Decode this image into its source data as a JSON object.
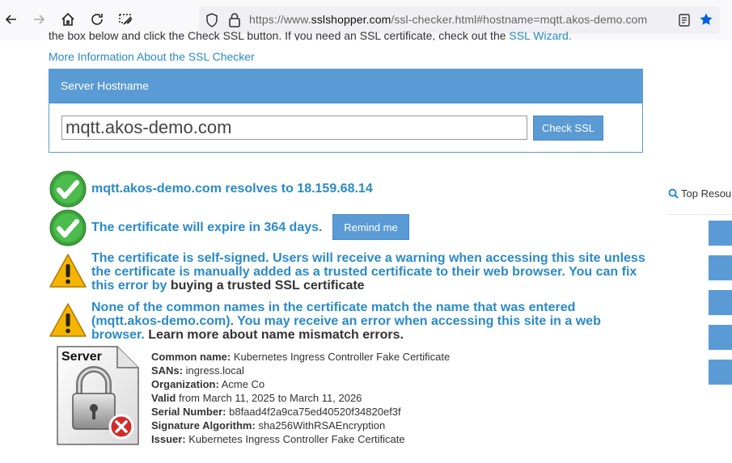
{
  "browser": {
    "url_prefix": "https://www.",
    "url_host": "sslshopper.com",
    "url_rest": "/ssl-checker.html#hostname=mqtt.akos-demo.com"
  },
  "page": {
    "cut_text": "the box below and click the Check SSL button. If you need an SSL certificate, check out the ",
    "cut_link": "SSL Wizard.",
    "more_info_link": "More Information About the SSL Checker"
  },
  "checker": {
    "panel_title": "Server Hostname",
    "hostname_value": "mqtt.akos-demo.com",
    "check_button": "Check SSL"
  },
  "results": {
    "resolve": "mqtt.akos-demo.com resolves to 18.159.68.14",
    "expiry": "The certificate will expire in 364 days.",
    "remind_button": "Remind me",
    "self_signed": "The certificate is self-signed. Users will receive a warning when accessing this site unless the certificate is manually added as a trusted certificate to their web browser. You can fix this error by",
    "self_signed_link": "buying a trusted SSL certificate",
    "mismatch": "None of the common names in the certificate match the name that was entered (mqtt.akos-demo.com). You may receive an error when accessing this site in a web browser.",
    "mismatch_link": "Learn more about name mismatch errors."
  },
  "certificate": {
    "icon_label": "Server",
    "common_name_label": "Common name:",
    "common_name": "Kubernetes Ingress Controller Fake Certificate",
    "sans_label": "SANs:",
    "sans": "ingress.local",
    "org_label": "Organization:",
    "org": "Acme Co",
    "valid_label": "Valid",
    "valid": "from March 11, 2025 to March 11, 2026",
    "serial_label": "Serial Number:",
    "serial": "b8faad4f2a9ca75ed40520f34820ef3f",
    "sig_label": "Signature Algorithm:",
    "sig": "sha256WithRSAEncryption",
    "issuer_label": "Issuer:",
    "issuer": "Kubernetes Ingress Controller Fake Certificate"
  },
  "sidebar": {
    "title": "Top Resou"
  },
  "colors": {
    "accent": "#5b9bd5",
    "link": "#2a8ac8",
    "success": "#3aa33a",
    "warning": "#f5b400"
  }
}
